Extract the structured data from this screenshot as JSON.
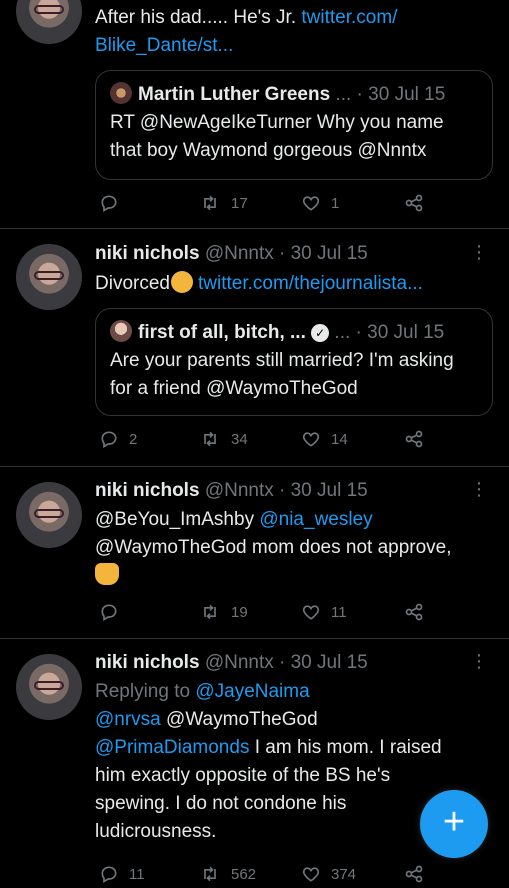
{
  "tweets": [
    {
      "text_part1": "After his dad..... He's Jr. ",
      "link_part1": "twitter.com/",
      "link_part2": "Blike_Dante/st...",
      "quote": {
        "name": "Martin Luther Greens",
        "meta": " ... · 30 Jul 15",
        "text": "RT @NewAgeIkeTurner Why you name that boy Waymond gorgeous @Nnntx"
      },
      "actions": {
        "reply": "",
        "retweet": "17",
        "like": "1"
      }
    },
    {
      "name": "niki nichols",
      "handle": "@Nnntx · 30 Jul 15",
      "text": "Divorced",
      "link": "twitter.com/thejournalista...",
      "quote": {
        "name": "first of all, bitch, ...",
        "meta": " ... · 30 Jul 15",
        "text": "Are your parents still married? I'm asking for a friend @WaymoTheGod"
      },
      "actions": {
        "reply": "2",
        "retweet": "34",
        "like": "14"
      }
    },
    {
      "name": "niki nichols",
      "handle": "@Nnntx · 30 Jul 15",
      "mention1": "@BeYou_ImAshby",
      "mention2": "@nia_wesley",
      "text_line2": "@WaymoTheGod mom does not approve,",
      "actions": {
        "reply": "",
        "retweet": "19",
        "like": "11"
      }
    },
    {
      "name": "niki nichols",
      "handle": "@Nnntx · 30 Jul 15",
      "replying_to": "Replying to ",
      "replying_handle": "@JayeNaima",
      "line1_link": "@nrvsa",
      "line1_rest": " @WaymoTheGod",
      "line2_link": "@PrimaDiamonds",
      "line2_rest": " I am his mom. I raised",
      "line3": "him exactly opposite of the BS he's",
      "line4": "spewing. I do not condone his",
      "line5": "ludicrousness.",
      "actions": {
        "reply": "11",
        "retweet": "562",
        "like": "374"
      }
    }
  ],
  "fab_label": "+",
  "more_label": "⋮",
  "colors": {
    "accent": "#1d9bf0",
    "background": "#000000",
    "muted": "#71767b",
    "border": "#2f3336"
  }
}
